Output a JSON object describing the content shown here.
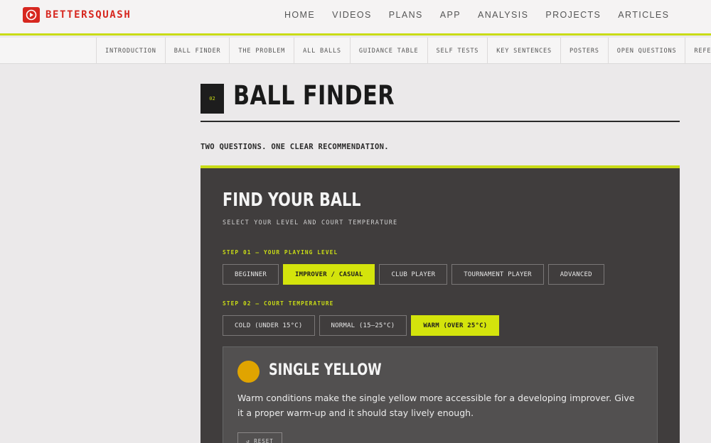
{
  "brand": {
    "name": "BETTERSQUASH",
    "accent": "#c9dc16",
    "brand_color": "#d7271f"
  },
  "main_nav": [
    "HOME",
    "VIDEOS",
    "PLANS",
    "APP",
    "ANALYSIS",
    "PROJECTS",
    "ARTICLES"
  ],
  "sub_nav": [
    "INTRODUCTION",
    "BALL FINDER",
    "THE PROBLEM",
    "ALL BALLS",
    "GUIDANCE TABLE",
    "SELF TESTS",
    "KEY SENTENCES",
    "POSTERS",
    "OPEN QUESTIONS",
    "REFERENCES"
  ],
  "section": {
    "number": "02",
    "title": "BALL FINDER",
    "subtitle": "TWO QUESTIONS. ONE CLEAR RECOMMENDATION."
  },
  "finder": {
    "title": "FIND YOUR BALL",
    "subtitle": "SELECT YOUR LEVEL AND COURT TEMPERATURE",
    "step1_label": "STEP 01 — YOUR PLAYING LEVEL",
    "levels": [
      "BEGINNER",
      "IMPROVER / CASUAL",
      "CLUB PLAYER",
      "TOURNAMENT PLAYER",
      "ADVANCED"
    ],
    "selected_level": "IMPROVER / CASUAL",
    "step2_label": "STEP 02 — COURT TEMPERATURE",
    "temperatures": [
      "COLD (UNDER 15°C)",
      "NORMAL (15–25°C)",
      "WARM (OVER 25°C)"
    ],
    "selected_temperature": "WARM (OVER 25°C)",
    "result": {
      "ball_color": "#e0a400",
      "title": "SINGLE YELLOW",
      "text": "Warm conditions make the single yellow more accessible for a developing improver. Give it a proper warm-up and it should stay lively enough.",
      "reset_label": "↺ RESET"
    }
  }
}
